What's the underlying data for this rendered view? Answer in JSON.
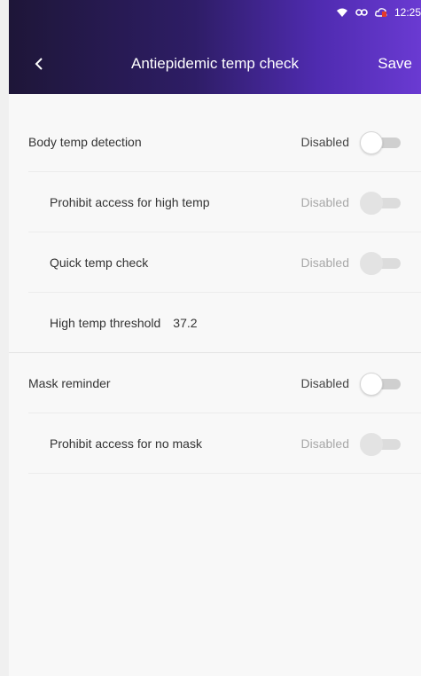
{
  "status_bar": {
    "time": "12:25",
    "icons": [
      "wifi-icon",
      "link-icon",
      "cloud-alert-icon"
    ]
  },
  "header": {
    "title": "Antiepidemic temp check",
    "save_label": "Save",
    "back_icon": "chevron-left-icon"
  },
  "sections": [
    {
      "rows": [
        {
          "label": "Body temp detection",
          "status": "Disabled",
          "toggle_on": false,
          "enabled": true
        },
        {
          "label": "Prohibit access for high temp",
          "status": "Disabled",
          "toggle_on": false,
          "enabled": false
        },
        {
          "label": "Quick temp check",
          "status": "Disabled",
          "toggle_on": false,
          "enabled": false
        },
        {
          "label": "High temp threshold",
          "value": "37.2"
        }
      ]
    },
    {
      "rows": [
        {
          "label": "Mask reminder",
          "status": "Disabled",
          "toggle_on": false,
          "enabled": true
        },
        {
          "label": "Prohibit access for no mask",
          "status": "Disabled",
          "toggle_on": false,
          "enabled": false
        }
      ]
    }
  ],
  "colors": {
    "header_start": "#1e1638",
    "header_end": "#6a3ad2",
    "toggle_track": "#cfcfcf"
  }
}
